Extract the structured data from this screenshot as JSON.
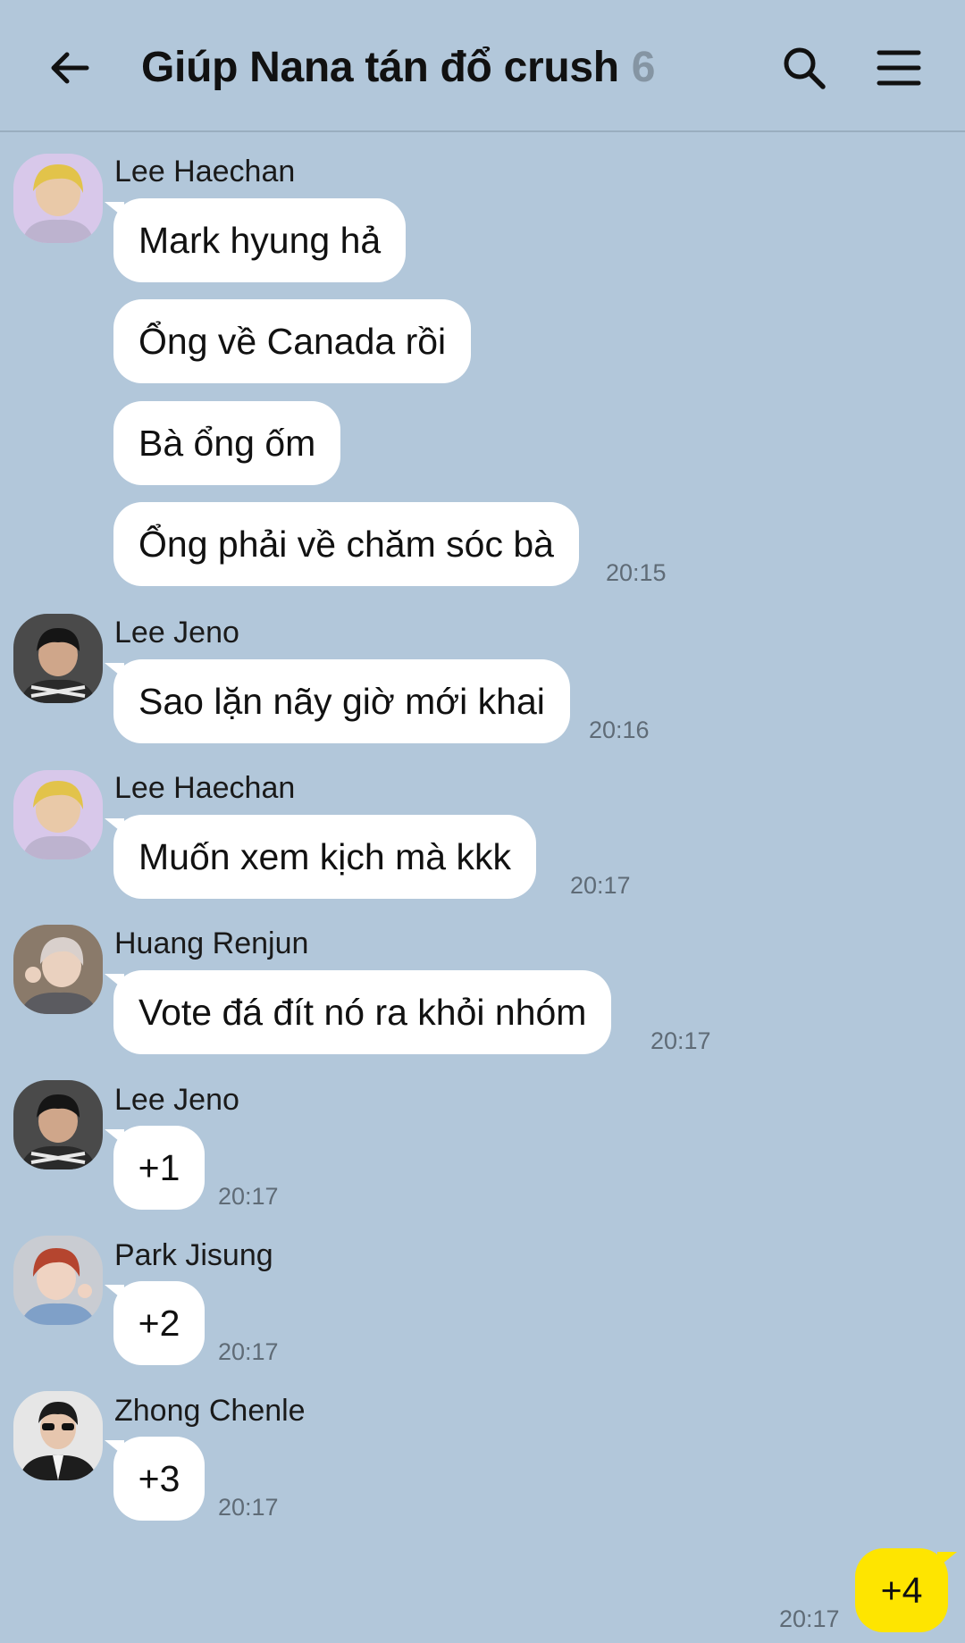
{
  "header": {
    "title": "Giúp Nana tán đổ crush",
    "member_count": "6",
    "back_icon": "arrow-left-icon",
    "search_icon": "search-icon",
    "menu_icon": "menu-icon"
  },
  "messages": [
    {
      "sender": "Lee Haechan",
      "bubbles": [
        "Mark hyung hả",
        "Ổng về Canada rồi",
        "Bà ổng ốm",
        "Ổng phải về chăm sóc bà"
      ],
      "time": "20:15"
    },
    {
      "sender": "Lee Jeno",
      "bubbles": [
        "Sao lặn nãy giờ mới khai"
      ],
      "time": "20:16"
    },
    {
      "sender": "Lee Haechan",
      "bubbles": [
        "Muốn xem kịch mà kkk"
      ],
      "time": "20:17"
    },
    {
      "sender": "Huang Renjun",
      "bubbles": [
        "Vote đá đít nó ra khỏi nhóm"
      ],
      "time": "20:17"
    },
    {
      "sender": "Lee Jeno",
      "bubbles": [
        "+1"
      ],
      "time": "20:17"
    },
    {
      "sender": "Park Jisung",
      "bubbles": [
        "+2"
      ],
      "time": "20:17"
    },
    {
      "sender": "Zhong Chenle",
      "bubbles": [
        "+3"
      ],
      "time": "20:17"
    }
  ],
  "my_message": {
    "text": "+4",
    "time": "20:17"
  },
  "colors": {
    "background": "#b2c7da",
    "bubble_other": "#ffffff",
    "bubble_mine": "#fee500",
    "member_count": "#8595a3"
  }
}
